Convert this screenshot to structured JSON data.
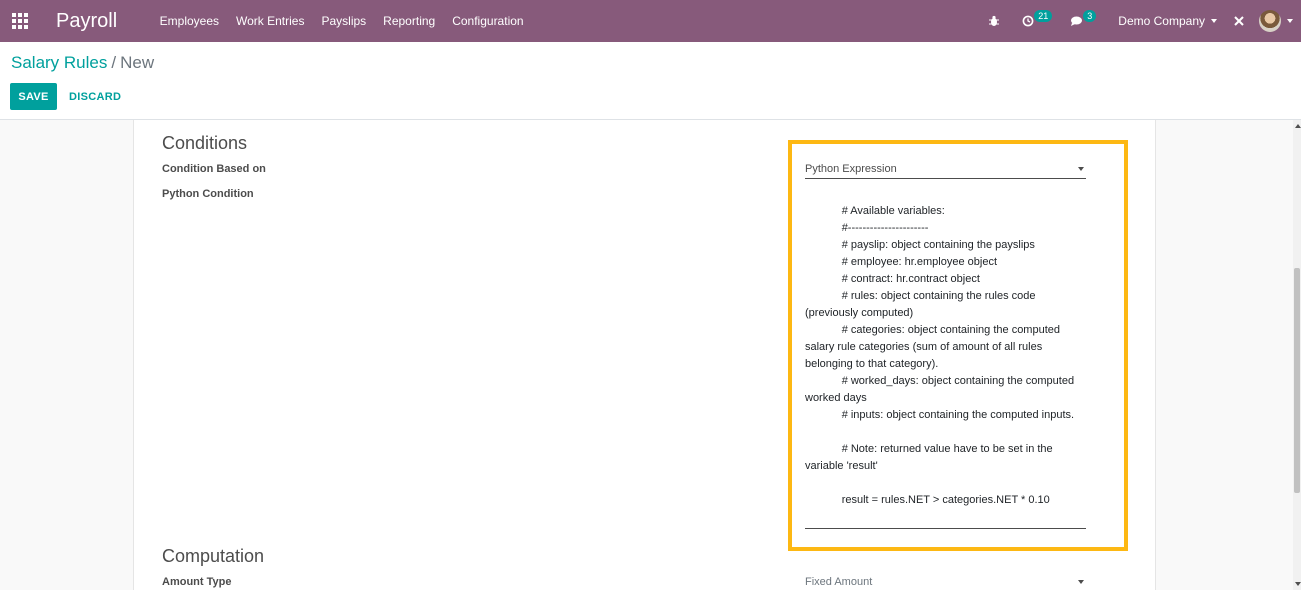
{
  "navbar": {
    "brand": "Payroll",
    "menu": [
      "Employees",
      "Work Entries",
      "Payslips",
      "Reporting",
      "Configuration"
    ],
    "activity_count": "21",
    "message_count": "3",
    "company": "Demo Company"
  },
  "breadcrumb": {
    "parent": "Salary Rules",
    "separator": "/",
    "current": "New"
  },
  "buttons": {
    "save": "SAVE",
    "discard": "DISCARD"
  },
  "conditions": {
    "title": "Conditions",
    "condition_based_on_label": "Condition Based on",
    "condition_based_on_value": "Python Expression",
    "python_condition_label": "Python Condition",
    "python_condition_code": "            # Available variables:\n            #----------------------\n            # payslip: object containing the payslips\n            # employee: hr.employee object\n            # contract: hr.contract object\n            # rules: object containing the rules code (previously computed)\n            # categories: object containing the computed salary rule categories (sum of amount of all rules belonging to that category).\n            # worked_days: object containing the computed worked days\n            # inputs: object containing the computed inputs.\n\n            # Note: returned value have to be set in the variable 'result'\n\n            result = rules.NET > categories.NET * 0.10"
  },
  "computation": {
    "title": "Computation",
    "amount_type_label": "Amount Type",
    "amount_type_value": "Fixed Amount"
  },
  "colors": {
    "navbar": "#875a7b",
    "accent": "#00a09d",
    "highlight": "#fdb813"
  }
}
